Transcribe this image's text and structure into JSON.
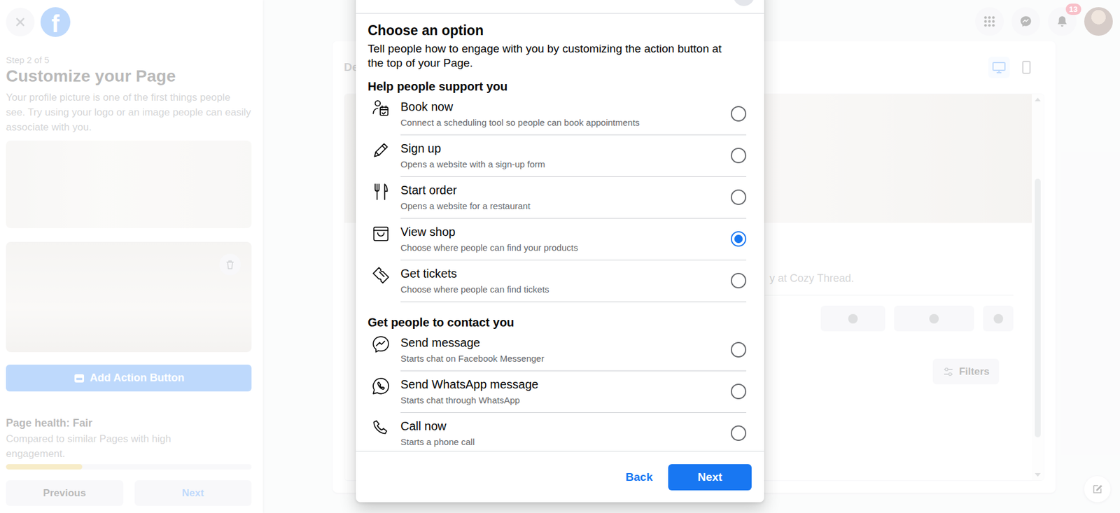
{
  "sidebar": {
    "logo": "f",
    "step": "Step 2 of 5",
    "title": "Customize your Page",
    "description": "Your profile picture is one of the first things people see. Try using your logo or an image people can easily associate with you.",
    "add_action_button": "Add Action Button",
    "health": {
      "title": "Page health: Fair",
      "note": "Compared to similar Pages with high engagement.",
      "level": 0.31
    },
    "buttons": [
      {
        "label": "Previous",
        "kind": "secondary"
      },
      {
        "label": "Next",
        "kind": "accent"
      }
    ]
  },
  "topbar": {
    "notification_count": "13"
  },
  "preview": {
    "label": "De",
    "view_modes": [
      {
        "kind": "desktop",
        "selected": true
      },
      {
        "kind": "mobile",
        "selected": false
      }
    ],
    "bio": "y at Cozy Thread.",
    "filters": "Filters"
  },
  "dialog": {
    "title": "Choose an option",
    "description": "Tell people how to engage with you by customizing the action button at the top of your Page.",
    "sections": [
      {
        "title": "Help people support you",
        "options": [
          {
            "label": "Book now",
            "description": "Connect a scheduling tool so people can book appointments",
            "kind": "book",
            "selected": false
          },
          {
            "label": "Sign up",
            "description": "Opens a website with a sign-up form",
            "kind": "pencil",
            "selected": false
          },
          {
            "label": "Start order",
            "description": "Opens a website for a restaurant",
            "kind": "utensils",
            "selected": false
          },
          {
            "label": "View shop",
            "description": "Choose where people can find your products",
            "kind": "shop",
            "selected": true
          },
          {
            "label": "Get tickets",
            "description": "Choose where people can find tickets",
            "kind": "ticket",
            "selected": false
          }
        ]
      },
      {
        "title": "Get people to contact you",
        "options": [
          {
            "label": "Send message",
            "description": "Starts chat on Facebook Messenger",
            "kind": "messenger",
            "selected": false
          },
          {
            "label": "Send WhatsApp message",
            "description": "Starts chat through WhatsApp",
            "kind": "whatsapp",
            "selected": false
          },
          {
            "label": "Call now",
            "description": "Starts a phone call",
            "kind": "phone",
            "selected": false
          }
        ]
      }
    ],
    "buttons": [
      {
        "label": "Back",
        "kind": "link"
      },
      {
        "label": "Next",
        "kind": "primary"
      }
    ]
  }
}
